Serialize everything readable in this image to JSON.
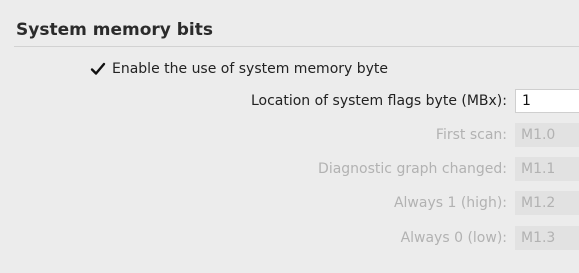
{
  "section": {
    "title": "System memory bits"
  },
  "enable_checkbox": {
    "label": "Enable the use of system memory byte",
    "checked": true,
    "icon": "checkmark-icon"
  },
  "fields": {
    "location": {
      "label": "Location of system flags byte (MBx):",
      "value": "1",
      "enabled": true
    },
    "first_scan": {
      "label": "First scan:",
      "value": "M1.0",
      "enabled": false
    },
    "diagnostic_graph_changed": {
      "label": "Diagnostic graph changed:",
      "value": "M1.1",
      "enabled": false
    },
    "always_1_high": {
      "label": "Always 1 (high):",
      "value": "M1.2",
      "enabled": false
    },
    "always_0_low": {
      "label": "Always 0 (low):",
      "value": "M1.3",
      "enabled": false
    }
  },
  "colors": {
    "background": "#ececec",
    "text": "#222222",
    "disabled_text": "#b2b2b2",
    "disabled_field": "#e2e2e2",
    "field": "#ffffff"
  }
}
